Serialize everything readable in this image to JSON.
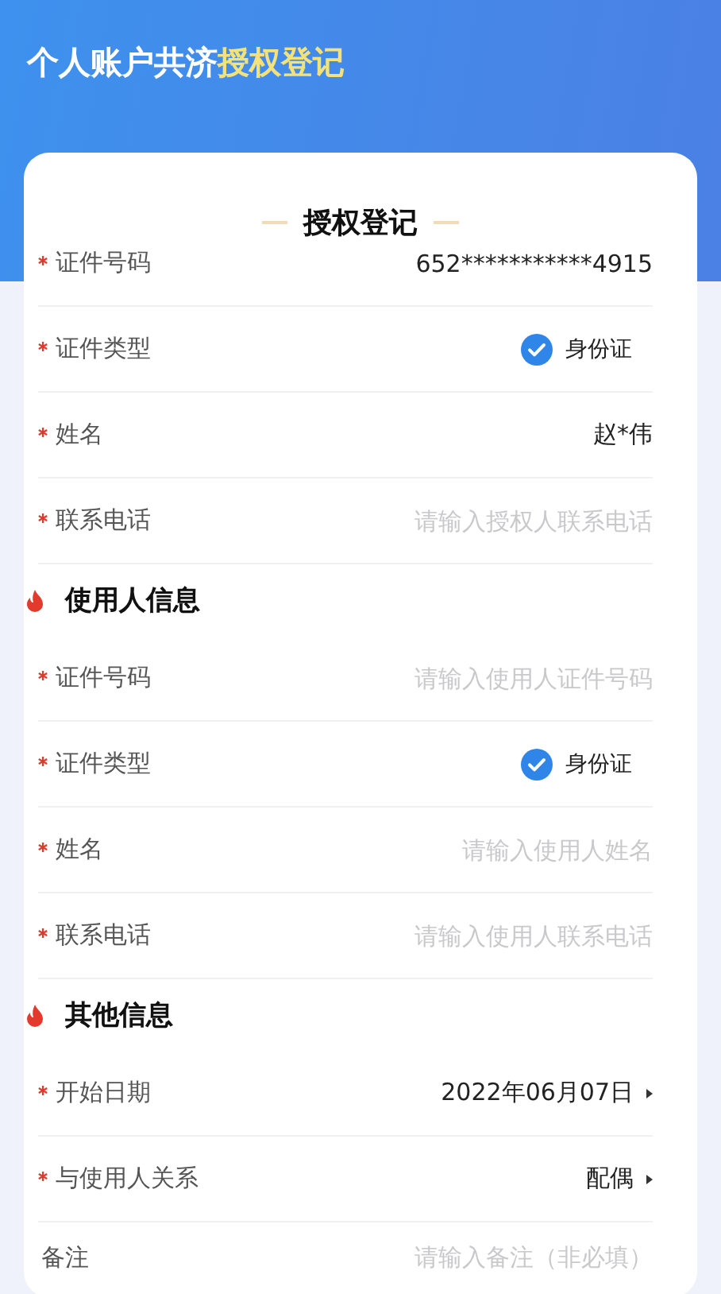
{
  "header": {
    "title": "个人账户共济",
    "title_highlight": "授权登记"
  },
  "card_title": "授权登记",
  "sections": [
    {
      "fields": [
        {
          "kind": "text",
          "required": true,
          "label": "证件号码",
          "value": "652***********4915"
        },
        {
          "kind": "radio",
          "required": true,
          "label": "证件类型",
          "option": "身份证",
          "checked": true
        },
        {
          "kind": "text",
          "required": true,
          "label": "姓名",
          "value": "赵*伟"
        },
        {
          "kind": "input",
          "required": true,
          "label": "联系电话",
          "placeholder": "请输入授权人联系电话"
        }
      ]
    },
    {
      "heading": "使用人信息",
      "fields": [
        {
          "kind": "input",
          "required": true,
          "label": "证件号码",
          "placeholder": "请输入使用人证件号码"
        },
        {
          "kind": "radio",
          "required": true,
          "label": "证件类型",
          "option": "身份证",
          "checked": true
        },
        {
          "kind": "input",
          "required": true,
          "label": "姓名",
          "placeholder": "请输入使用人姓名"
        },
        {
          "kind": "input",
          "required": true,
          "label": "联系电话",
          "placeholder": "请输入使用人联系电话"
        }
      ]
    },
    {
      "heading": "其他信息",
      "fields": [
        {
          "kind": "select",
          "required": true,
          "label": "开始日期",
          "value": "2022年06月07日"
        },
        {
          "kind": "select",
          "required": true,
          "label": "与使用人关系",
          "value": "配偶"
        },
        {
          "kind": "input",
          "required": false,
          "label": "备注",
          "placeholder": "请输入备注（非必填）"
        }
      ]
    }
  ]
}
